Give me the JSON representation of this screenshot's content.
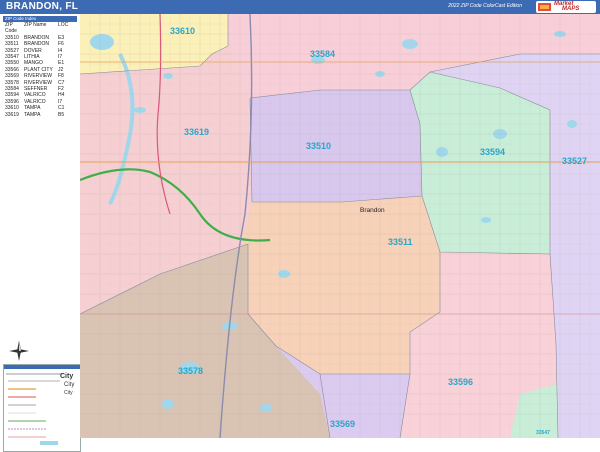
{
  "header": {
    "title": "BRANDON, FL",
    "edition": "2022 ZIP Code ColorCast Edition",
    "logo_left": "Market",
    "logo_right": "MAPS"
  },
  "legend_table": {
    "title": "ZIP Code Index",
    "headers": [
      "ZIP Code",
      "ZIP Name",
      "LOC"
    ],
    "rows": [
      [
        "33510",
        "BRANDON",
        "E3"
      ],
      [
        "33511",
        "BRANDON",
        "F6"
      ],
      [
        "33527",
        "DOVER",
        "I4"
      ],
      [
        "33547",
        "LITHIA",
        "I7"
      ],
      [
        "33550",
        "MANGO",
        "E1"
      ],
      [
        "33566",
        "PLANT CITY",
        "J2"
      ],
      [
        "33569",
        "RIVERVIEW",
        "F8"
      ],
      [
        "33578",
        "RIVERVIEW",
        "C7"
      ],
      [
        "33584",
        "SEFFNER",
        "F2"
      ],
      [
        "33594",
        "VALRICO",
        "H4"
      ],
      [
        "33596",
        "VALRICO",
        "I7"
      ],
      [
        "33610",
        "TAMPA",
        "C1"
      ],
      [
        "33619",
        "TAMPA",
        "B5"
      ]
    ]
  },
  "map": {
    "zip_labels": [
      "33610",
      "33584",
      "33619",
      "33510",
      "33594",
      "33527",
      "33511",
      "33578",
      "33596",
      "33569",
      "33547"
    ],
    "place_labels": [
      "Brandon"
    ],
    "zone_colors": {
      "33610": "#fbf1b8",
      "33584": "#f8cfd8",
      "33619": "#f6cfd2",
      "33510": "#d8c8ee",
      "33594": "#c8eed8",
      "33527": "#e0d4f4",
      "33511": "#f7d2b8",
      "33578": "#d9c4b4",
      "33596": "#f8d2d8",
      "33569": "#dccbf0",
      "33547": "#c8eed8"
    },
    "water_color": "#9fd8ec",
    "highway_color": "#3fae49"
  },
  "key": {
    "city_large": "City",
    "city_medium": "City",
    "city_small": "City"
  }
}
